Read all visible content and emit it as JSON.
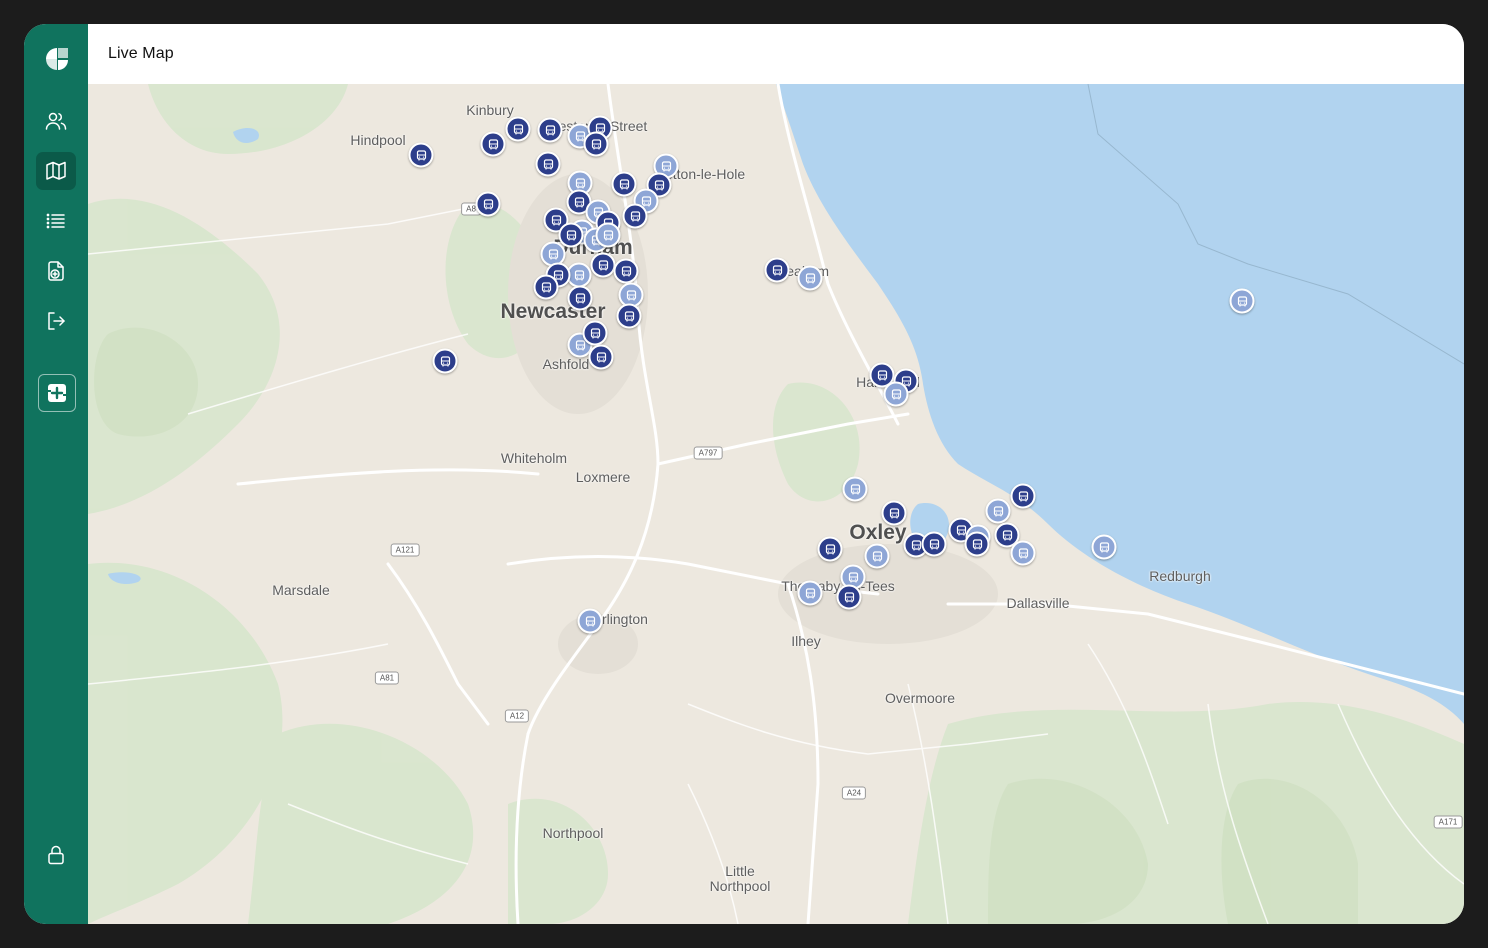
{
  "app": {
    "page_title": "Live Map"
  },
  "sidebar": {
    "items": [
      {
        "name": "users",
        "icon": "users-icon",
        "active": false
      },
      {
        "name": "map",
        "icon": "map-icon",
        "active": true
      },
      {
        "name": "list",
        "icon": "list-icon",
        "active": false
      },
      {
        "name": "add-document",
        "icon": "file-plus-icon",
        "active": false
      },
      {
        "name": "logout",
        "icon": "logout-icon",
        "active": false
      },
      {
        "name": "plugin",
        "icon": "square-plus-icon",
        "active": false
      }
    ],
    "lock_icon": "lock-icon"
  },
  "colors": {
    "sidebar": "#10735e",
    "bus_active": "#2d3e8b",
    "bus_inactive": "#8ea6d6",
    "sea": "#b1d3ef"
  },
  "map": {
    "places": [
      {
        "id": "kinbury",
        "label": "Kinbury"
      },
      {
        "id": "hindpool",
        "label": "Hindpool"
      },
      {
        "id": "chester",
        "label": "Chester-le-Street"
      },
      {
        "id": "hetton",
        "label": "Hetton-le-Hole"
      },
      {
        "id": "durham",
        "label": "Durham"
      },
      {
        "id": "seaham",
        "label": "Seaham"
      },
      {
        "id": "newcaster",
        "label": "Newcaster"
      },
      {
        "id": "ashfold",
        "label": "Ashfold"
      },
      {
        "id": "hartlepool",
        "label": "Hartlepool"
      },
      {
        "id": "whiteholm",
        "label": "Whiteholm"
      },
      {
        "id": "loxmere",
        "label": "Loxmere"
      },
      {
        "id": "oxley",
        "label": "Oxley"
      },
      {
        "id": "thornaby",
        "label": "Thornaby-on-Tees"
      },
      {
        "id": "redburgh",
        "label": "Redburgh"
      },
      {
        "id": "dallasville",
        "label": "Dallasville"
      },
      {
        "id": "marsdale",
        "label": "Marsdale"
      },
      {
        "id": "darlington",
        "label": "Darlington"
      },
      {
        "id": "ilhey",
        "label": "Ilhey"
      },
      {
        "id": "overmoore",
        "label": "Overmoore"
      },
      {
        "id": "northpool",
        "label": "Northpool"
      },
      {
        "id": "little-northpool",
        "label": "Little Northpool"
      }
    ],
    "roads": [
      "A8",
      "A797",
      "A121",
      "A81",
      "A12",
      "A24",
      "A171"
    ],
    "buses": [
      {
        "status": "active"
      },
      {
        "status": "active"
      },
      {
        "status": "active"
      },
      {
        "status": "active"
      },
      {
        "status": "inactive"
      },
      {
        "status": "active"
      },
      {
        "status": "active"
      },
      {
        "status": "inactive"
      },
      {
        "status": "active"
      },
      {
        "status": "inactive"
      },
      {
        "status": "active"
      },
      {
        "status": "active"
      },
      {
        "status": "inactive"
      },
      {
        "status": "active"
      },
      {
        "status": "active"
      },
      {
        "status": "inactive"
      },
      {
        "status": "active"
      },
      {
        "status": "active"
      },
      {
        "status": "active"
      },
      {
        "status": "inactive"
      },
      {
        "status": "inactive"
      },
      {
        "status": "inactive"
      },
      {
        "status": "active"
      },
      {
        "status": "inactive"
      },
      {
        "status": "active"
      },
      {
        "status": "active"
      },
      {
        "status": "inactive"
      },
      {
        "status": "active"
      },
      {
        "status": "active"
      },
      {
        "status": "active"
      },
      {
        "status": "inactive"
      },
      {
        "status": "active"
      },
      {
        "status": "inactive"
      },
      {
        "status": "active"
      },
      {
        "status": "active"
      },
      {
        "status": "active"
      },
      {
        "status": "active"
      },
      {
        "status": "inactive"
      },
      {
        "status": "active"
      },
      {
        "status": "active"
      },
      {
        "status": "inactive"
      },
      {
        "status": "inactive"
      },
      {
        "status": "inactive"
      },
      {
        "status": "active"
      },
      {
        "status": "active"
      },
      {
        "status": "active"
      },
      {
        "status": "inactive"
      },
      {
        "status": "active"
      },
      {
        "status": "active"
      },
      {
        "status": "inactive"
      },
      {
        "status": "inactive"
      },
      {
        "status": "active"
      },
      {
        "status": "active"
      },
      {
        "status": "active"
      },
      {
        "status": "inactive"
      },
      {
        "status": "inactive"
      },
      {
        "status": "inactive"
      },
      {
        "status": "inactive"
      },
      {
        "status": "active"
      },
      {
        "status": "inactive"
      }
    ]
  }
}
